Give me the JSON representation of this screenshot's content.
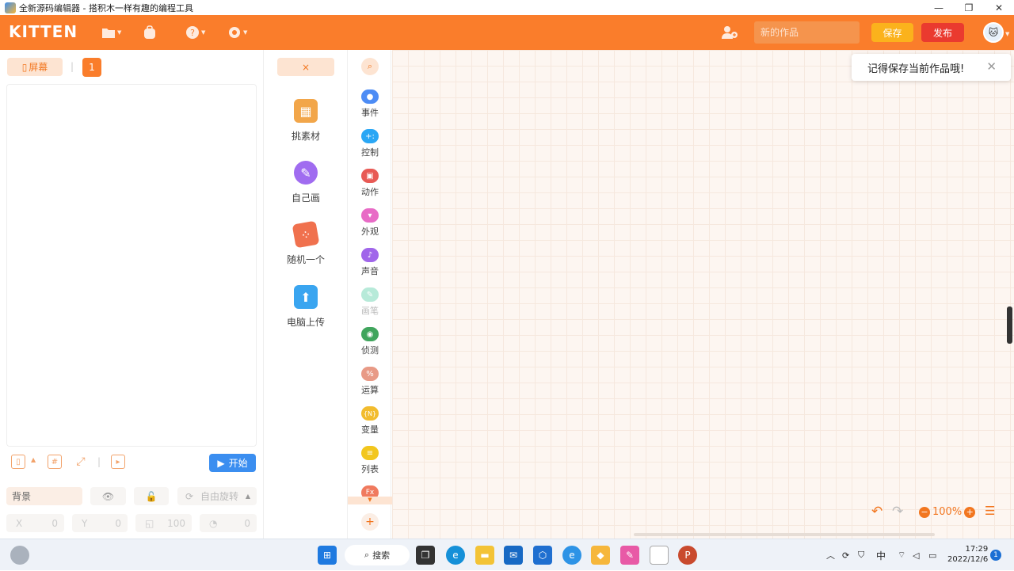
{
  "window": {
    "title": "全新源码编辑器 - 搭积木一样有趣的编程工具",
    "minimize": "—",
    "restore": "❐",
    "close": "✕"
  },
  "toolbar": {
    "logo": "KITTEN",
    "project_title_placeholder": "新的作品",
    "save_label": "保存",
    "publish_label": "发布"
  },
  "stage_panel": {
    "screen_tab": "屏幕",
    "page_number": "1",
    "start_label": "开始",
    "background_label": "背景",
    "rotation_label": "自由旋转",
    "coords": [
      {
        "label": "X",
        "value": "0"
      },
      {
        "label": "Y",
        "value": "0"
      },
      {
        "label": "",
        "value": "100"
      },
      {
        "label": "",
        "value": "0"
      }
    ]
  },
  "asset_panel": {
    "close_label": "×",
    "items": [
      {
        "label": "挑素材",
        "icon": "treasure-box-icon",
        "color": "#f2a64a"
      },
      {
        "label": "自己画",
        "icon": "palette-icon",
        "color": "#a06cf0"
      },
      {
        "label": "随机一个",
        "icon": "dice-icon",
        "color": "#f0714e"
      },
      {
        "label": "电脑上传",
        "icon": "upload-icon",
        "color": "#3aa5f0"
      }
    ]
  },
  "categories": [
    {
      "label": "事件",
      "color": "#4d8cf5",
      "glyph": "●"
    },
    {
      "label": "控制",
      "color": "#2aa7f5",
      "glyph": "+:"
    },
    {
      "label": "动作",
      "color": "#e85a55",
      "glyph": "▣"
    },
    {
      "label": "外观",
      "color": "#e86bc6",
      "glyph": "👕"
    },
    {
      "label": "声音",
      "color": "#a066ea",
      "glyph": "♪"
    },
    {
      "label": "画笔",
      "color": "#b7ead9",
      "glyph": "✎"
    },
    {
      "label": "侦测",
      "color": "#40a55d",
      "glyph": "◉"
    },
    {
      "label": "运算",
      "color": "#e89a86",
      "glyph": "%"
    },
    {
      "label": "变量",
      "color": "#f2bc2e",
      "glyph": "{N}"
    },
    {
      "label": "列表",
      "color": "#f2c61d",
      "glyph": "≡"
    },
    {
      "label": "",
      "color": "#f07a5e",
      "glyph": "Fx"
    }
  ],
  "canvas": {
    "toast_message": "记得保存当前作品哦!",
    "zoom_level": "100%"
  },
  "taskbar": {
    "search_label": "搜索",
    "ime": "中",
    "time": "17:29",
    "date": "2022/12/6",
    "notifications": "1"
  }
}
